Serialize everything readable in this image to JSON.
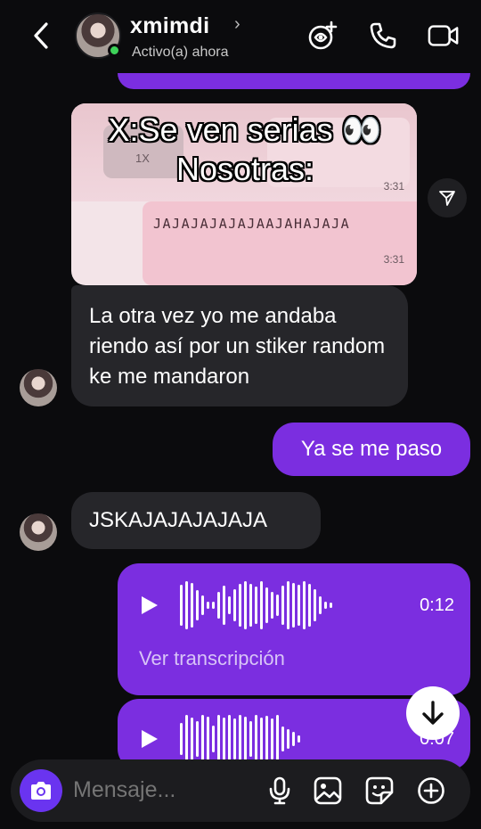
{
  "header": {
    "name": "xmimdi",
    "name_chevron": "›",
    "status": "Activo(a) ahora"
  },
  "overlay_caption": {
    "line1": "X:Se ven serias 👀",
    "line2": "Nosotras:"
  },
  "meme_image": {
    "speed_label": "1X",
    "time_top": "3:31",
    "jaja_text": "JAJAJAJAJAJAAJAHAJAJA",
    "time_bottom": "3:31"
  },
  "messages": [
    {
      "direction": "incoming",
      "text": "La otra vez yo me andaba riendo así por un stiker random ke me mandaron"
    },
    {
      "direction": "outgoing",
      "text": "Ya se me paso"
    },
    {
      "direction": "incoming",
      "text": "JSKAJAJAJAJAJA"
    }
  ],
  "voice_notes": [
    {
      "duration": "0:12",
      "transcript_link": "Ver transcripción"
    },
    {
      "duration": "0:07"
    }
  ],
  "composer": {
    "placeholder": "Mensaje..."
  },
  "colors": {
    "accent_purple": "#7b2ee0",
    "camera_button": "#6a34f0",
    "incoming_bubble": "#26262a",
    "online": "#3ed35a",
    "background": "#0b0b0d"
  },
  "icons": [
    "back-icon",
    "sticker-add-icon",
    "phone-icon",
    "video-call-icon",
    "share-icon",
    "play-icon",
    "arrow-down-icon",
    "camera-icon",
    "microphone-icon",
    "gallery-icon",
    "sticker-icon",
    "plus-circle-icon"
  ]
}
